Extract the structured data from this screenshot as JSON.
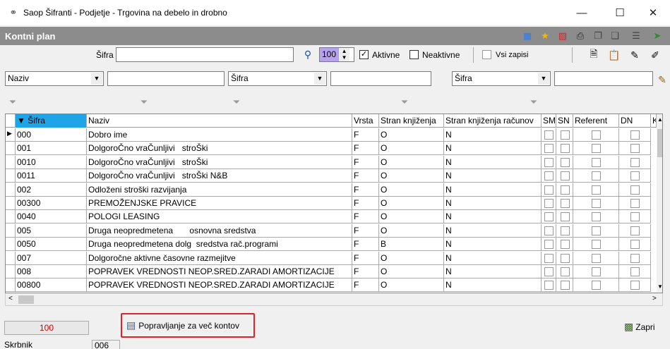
{
  "window": {
    "title": "Saop Šifranti  -  Podjetje - Trgovina na debelo in drobno",
    "min_glyph": "—",
    "max_glyph": "☐",
    "close_glyph": "✕"
  },
  "header": {
    "title": "Kontni plan",
    "icons": [
      "tree-icon",
      "star-icon",
      "delete-icon",
      "print-icon",
      "copy-icon",
      "paste-icon",
      "export-icon"
    ]
  },
  "search": {
    "sifra_label": "Šifra",
    "sifra_value": "",
    "limit_value": "100",
    "aktivne_label": "Aktivne",
    "aktivne_checked": true,
    "neaktivne_label": "Neaktivne",
    "neaktivne_checked": false,
    "vsi_label": "Vsi zapisi",
    "vsi_checked": false
  },
  "filters": [
    {
      "field": "Naziv",
      "value": ""
    },
    {
      "field": "Šifra",
      "value": ""
    },
    {
      "field": "Šifra",
      "value": ""
    }
  ],
  "grid": {
    "columns": [
      "Šifra",
      "Naziv",
      "Vrsta",
      "Stran knjiženja",
      "Stran knjiženja računov",
      "SM",
      "SN",
      "Referent",
      "DN",
      "K"
    ],
    "rows": [
      {
        "sifra": "000",
        "naziv": "Dobro ime",
        "vrsta": "F",
        "stran": "O",
        "stran_rac": "N"
      },
      {
        "sifra": "001",
        "naziv": "DolgoroČno vraČunljivi   stroŠki",
        "vrsta": "F",
        "stran": "O",
        "stran_rac": "N"
      },
      {
        "sifra": "0010",
        "naziv": "DolgoroČno vraČunljivi   stroŠki",
        "vrsta": "F",
        "stran": "O",
        "stran_rac": "N"
      },
      {
        "sifra": "0011",
        "naziv": "DolgoroČno vraČunljivi   stroŠki N&B",
        "vrsta": "F",
        "stran": "O",
        "stran_rac": "N"
      },
      {
        "sifra": "002",
        "naziv": "Odloženi stroški razvijanja",
        "vrsta": "F",
        "stran": "O",
        "stran_rac": "N"
      },
      {
        "sifra": "00300",
        "naziv": "PREMOŽENJSKE PRAVICE",
        "vrsta": "F",
        "stran": "O",
        "stran_rac": "N"
      },
      {
        "sifra": "0040",
        "naziv": "POLOGI LEASING",
        "vrsta": "F",
        "stran": "O",
        "stran_rac": "N"
      },
      {
        "sifra": "005",
        "naziv": "Druga neopredmetena       osnovna sredstva",
        "vrsta": "F",
        "stran": "O",
        "stran_rac": "N"
      },
      {
        "sifra": "0050",
        "naziv": "Druga neopredmetena dolg  sredstva rač.programi",
        "vrsta": "F",
        "stran": "B",
        "stran_rac": "N"
      },
      {
        "sifra": "007",
        "naziv": "Dolgoročne aktivne časovne razmejitve",
        "vrsta": "F",
        "stran": "O",
        "stran_rac": "N"
      },
      {
        "sifra": "008",
        "naziv": "POPRAVEK VREDNOSTI NEOP.SRED.ZARADI AMORTIZACIJE",
        "vrsta": "F",
        "stran": "O",
        "stran_rac": "N"
      },
      {
        "sifra": "00800",
        "naziv": "POPRAVEK VREDNOSTI NEOP.SRED.ZARADI AMORTIZACIJE",
        "vrsta": "F",
        "stran": "O",
        "stran_rac": "N"
      }
    ]
  },
  "footer": {
    "count": "100",
    "multi_edit_label": "Popravljanje za več kontov",
    "close_label": "Zapri",
    "status_key": "Skrbnik",
    "status_value": "006"
  }
}
